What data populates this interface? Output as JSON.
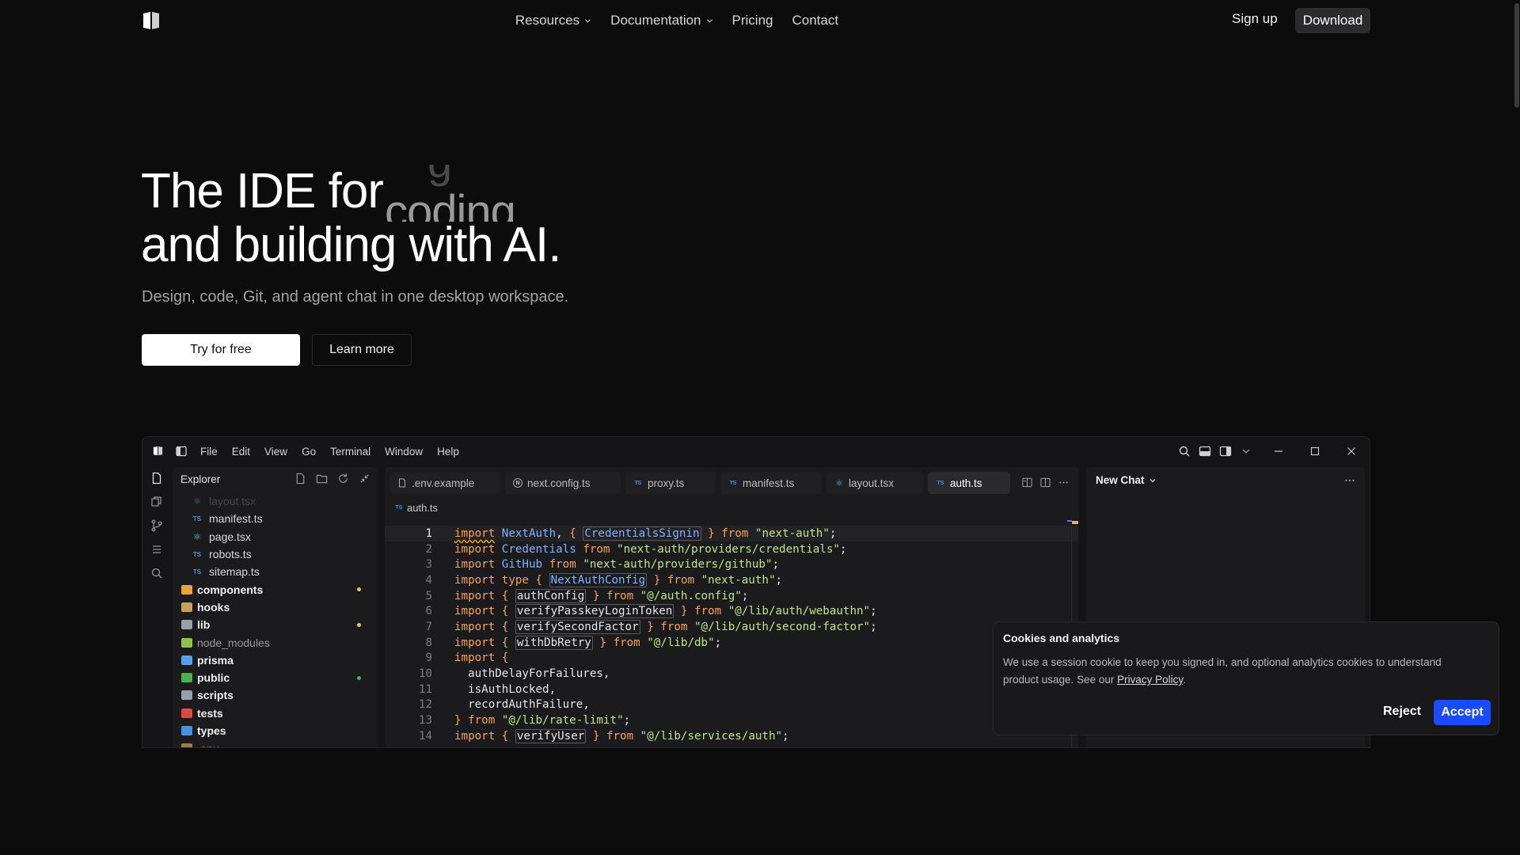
{
  "nav": {
    "links": [
      {
        "label": "Resources",
        "dropdown": true
      },
      {
        "label": "Documentation",
        "dropdown": true
      },
      {
        "label": "Pricing",
        "dropdown": false
      },
      {
        "label": "Contact",
        "dropdown": false
      }
    ],
    "signup_label": "Sign up",
    "download_label": "Download"
  },
  "hero": {
    "line1": "The IDE for",
    "rotating_word_current": "coding",
    "rotating_word_prev": "g",
    "line2": "and building with AI.",
    "subtitle": "Design, code, Git, and agent chat in one desktop workspace.",
    "primary_cta": "Try for free",
    "secondary_cta": "Learn more"
  },
  "ide": {
    "menus": [
      "File",
      "Edit",
      "View",
      "Go",
      "Terminal",
      "Window",
      "Help"
    ],
    "explorer": {
      "title": "Explorer",
      "items": [
        {
          "name": "layout.tsx",
          "type": "file",
          "kind": "react",
          "dim": true
        },
        {
          "name": "manifest.ts",
          "type": "file",
          "kind": "ts"
        },
        {
          "name": "page.tsx",
          "type": "file",
          "kind": "react"
        },
        {
          "name": "robots.ts",
          "type": "file",
          "kind": "ts"
        },
        {
          "name": "sitemap.ts",
          "type": "file",
          "kind": "ts"
        },
        {
          "name": "components",
          "type": "folder",
          "color": "#e8a33a",
          "dot": "#e8c060"
        },
        {
          "name": "hooks",
          "type": "folder",
          "color": "#c8a060"
        },
        {
          "name": "lib",
          "type": "folder",
          "color": "#9aa0aa",
          "dot": "#e8c060"
        },
        {
          "name": "node_modules",
          "type": "folder",
          "color": "#8bc34a",
          "faded": true
        },
        {
          "name": "prisma",
          "type": "folder",
          "color": "#5aa0e8"
        },
        {
          "name": "public",
          "type": "folder",
          "color": "#4caf50",
          "dot": "#4caf50"
        },
        {
          "name": "scripts",
          "type": "folder",
          "color": "#9aa0aa"
        },
        {
          "name": "tests",
          "type": "folder",
          "color": "#e04848"
        },
        {
          "name": "types",
          "type": "folder",
          "color": "#4a90e2"
        },
        {
          "name": ".env",
          "type": "folder",
          "color": "#e8c060",
          "dim": true
        }
      ]
    },
    "tabs": [
      {
        "label": ".env.example",
        "kind": "file"
      },
      {
        "label": "next.config.ts",
        "kind": "next"
      },
      {
        "label": "proxy.ts",
        "kind": "ts"
      },
      {
        "label": "manifest.ts",
        "kind": "ts"
      },
      {
        "label": "layout.tsx",
        "kind": "react"
      },
      {
        "label": "auth.ts",
        "kind": "ts",
        "active": true
      }
    ],
    "breadcrumb": "auth.ts",
    "code_lines": [
      {
        "n": "1",
        "tokens": [
          [
            "kw squig",
            "import"
          ],
          [
            "pl",
            " "
          ],
          [
            "id",
            "NextAuth"
          ],
          [
            "pl",
            ", "
          ],
          [
            "kw",
            "{"
          ],
          [
            "pl",
            " "
          ],
          [
            "id ub",
            "CredentialsSignin"
          ],
          [
            "pl",
            " "
          ],
          [
            "kw",
            "}"
          ],
          [
            "pl",
            " "
          ],
          [
            "kw",
            "from"
          ],
          [
            "pl",
            " "
          ],
          [
            "str",
            "\"next-auth\""
          ],
          [
            "pl",
            ";"
          ]
        ]
      },
      {
        "n": "2",
        "tokens": [
          [
            "kw",
            "import"
          ],
          [
            "pl",
            " "
          ],
          [
            "id",
            "Credentials"
          ],
          [
            "pl",
            " "
          ],
          [
            "kw",
            "from"
          ],
          [
            "pl",
            " "
          ],
          [
            "str",
            "\"next-auth/providers/credentials\""
          ],
          [
            "pl",
            ";"
          ]
        ]
      },
      {
        "n": "3",
        "tokens": [
          [
            "kw",
            "import"
          ],
          [
            "pl",
            " "
          ],
          [
            "id",
            "GitHub"
          ],
          [
            "pl",
            " "
          ],
          [
            "kw",
            "from"
          ],
          [
            "pl",
            " "
          ],
          [
            "str",
            "\"next-auth/providers/github\""
          ],
          [
            "pl",
            ";"
          ]
        ]
      },
      {
        "n": "4",
        "tokens": [
          [
            "kw",
            "import"
          ],
          [
            "pl",
            " "
          ],
          [
            "kw",
            "type"
          ],
          [
            "pl",
            " "
          ],
          [
            "kw",
            "{"
          ],
          [
            "pl",
            " "
          ],
          [
            "id ub",
            "NextAuthConfig"
          ],
          [
            "pl",
            " "
          ],
          [
            "kw",
            "}"
          ],
          [
            "pl",
            " "
          ],
          [
            "kw",
            "from"
          ],
          [
            "pl",
            " "
          ],
          [
            "str",
            "\"next-auth\""
          ],
          [
            "pl",
            ";"
          ]
        ]
      },
      {
        "n": "5",
        "tokens": [
          [
            "kw",
            "import"
          ],
          [
            "pl",
            " "
          ],
          [
            "kw",
            "{"
          ],
          [
            "pl",
            " "
          ],
          [
            "pl ub",
            "authConfig"
          ],
          [
            "pl",
            " "
          ],
          [
            "kw",
            "}"
          ],
          [
            "pl",
            " "
          ],
          [
            "kw",
            "from"
          ],
          [
            "pl",
            " "
          ],
          [
            "str",
            "\"@/auth.config\""
          ],
          [
            "pl",
            ";"
          ]
        ]
      },
      {
        "n": "6",
        "tokens": [
          [
            "kw",
            "import"
          ],
          [
            "pl",
            " "
          ],
          [
            "kw",
            "{"
          ],
          [
            "pl",
            " "
          ],
          [
            "pl ub",
            "verifyPasskeyLoginToken"
          ],
          [
            "pl",
            " "
          ],
          [
            "kw",
            "}"
          ],
          [
            "pl",
            " "
          ],
          [
            "kw",
            "from"
          ],
          [
            "pl",
            " "
          ],
          [
            "str",
            "\"@/lib/auth/webauthn\""
          ],
          [
            "pl",
            ";"
          ]
        ]
      },
      {
        "n": "7",
        "tokens": [
          [
            "kw",
            "import"
          ],
          [
            "pl",
            " "
          ],
          [
            "kw",
            "{"
          ],
          [
            "pl",
            " "
          ],
          [
            "pl ub",
            "verifySecondFactor"
          ],
          [
            "pl",
            " "
          ],
          [
            "kw",
            "}"
          ],
          [
            "pl",
            " "
          ],
          [
            "kw",
            "from"
          ],
          [
            "pl",
            " "
          ],
          [
            "str",
            "\"@/lib/auth/second-factor\""
          ],
          [
            "pl",
            ";"
          ]
        ]
      },
      {
        "n": "8",
        "tokens": [
          [
            "kw",
            "import"
          ],
          [
            "pl",
            " "
          ],
          [
            "kw",
            "{"
          ],
          [
            "pl",
            " "
          ],
          [
            "pl ub",
            "withDbRetry"
          ],
          [
            "pl",
            " "
          ],
          [
            "kw",
            "}"
          ],
          [
            "pl",
            " "
          ],
          [
            "kw",
            "from"
          ],
          [
            "pl",
            " "
          ],
          [
            "str",
            "\"@/lib/db\""
          ],
          [
            "pl",
            ";"
          ]
        ]
      },
      {
        "n": "9",
        "tokens": [
          [
            "kw",
            "import"
          ],
          [
            "pl",
            " "
          ],
          [
            "kw",
            "{"
          ]
        ]
      },
      {
        "n": "10",
        "tokens": [
          [
            "pl",
            "  authDelayForFailures,"
          ]
        ]
      },
      {
        "n": "11",
        "tokens": [
          [
            "pl",
            "  isAuthLocked,"
          ]
        ]
      },
      {
        "n": "12",
        "tokens": [
          [
            "pl",
            "  recordAuthFailure,"
          ]
        ]
      },
      {
        "n": "13",
        "tokens": [
          [
            "kw",
            "}"
          ],
          [
            "pl",
            " "
          ],
          [
            "kw",
            "from"
          ],
          [
            "pl",
            " "
          ],
          [
            "str",
            "\"@/lib/rate-limit\""
          ],
          [
            "pl",
            ";"
          ]
        ]
      },
      {
        "n": "14",
        "tokens": [
          [
            "kw",
            "import"
          ],
          [
            "pl",
            " "
          ],
          [
            "kw",
            "{"
          ],
          [
            "pl",
            " "
          ],
          [
            "pl ub",
            "verifyUser"
          ],
          [
            "pl",
            " "
          ],
          [
            "kw",
            "}"
          ],
          [
            "pl",
            " "
          ],
          [
            "kw",
            "from"
          ],
          [
            "pl",
            " "
          ],
          [
            "str",
            "\"@/lib/services/auth\""
          ],
          [
            "pl",
            ";"
          ]
        ]
      }
    ],
    "chat": {
      "title": "New Chat"
    }
  },
  "cookie": {
    "title": "Cookies and analytics",
    "text": "We use a session cookie to keep you signed in, and optional analytics cookies to understand product usage. See our ",
    "link": "Privacy Policy",
    "text_end": ".",
    "reject_label": "Reject",
    "accept_label": "Accept"
  },
  "colors": {
    "background": "#0c0c0d",
    "accent_blue": "#1a4cff",
    "keyword": "#f5a35a",
    "identifier": "#7fb2ff",
    "string": "#c0e48c"
  }
}
